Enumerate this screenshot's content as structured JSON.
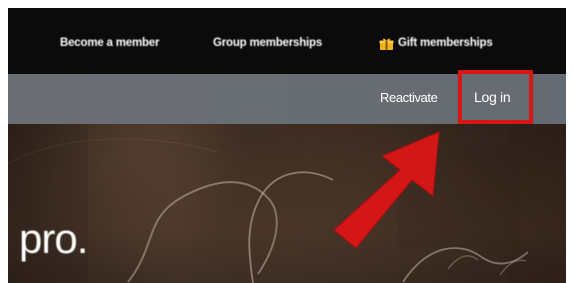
{
  "header": {
    "links": {
      "become_member": "Become a member",
      "group_memberships": "Group memberships",
      "gift_memberships": "Gift memberships"
    },
    "icons": {
      "gift": "gift-icon"
    }
  },
  "account_bar": {
    "reactivate": "Reactivate",
    "login": "Log in"
  },
  "hero": {
    "text": "pro."
  },
  "annotation": {
    "highlight": "highlight-box",
    "arrow": "arrow-icon",
    "color": "#d71616"
  },
  "colors": {
    "topbar": "#0b0b0b",
    "subbar": "#6b6f74",
    "accent": "#f3b21c"
  }
}
